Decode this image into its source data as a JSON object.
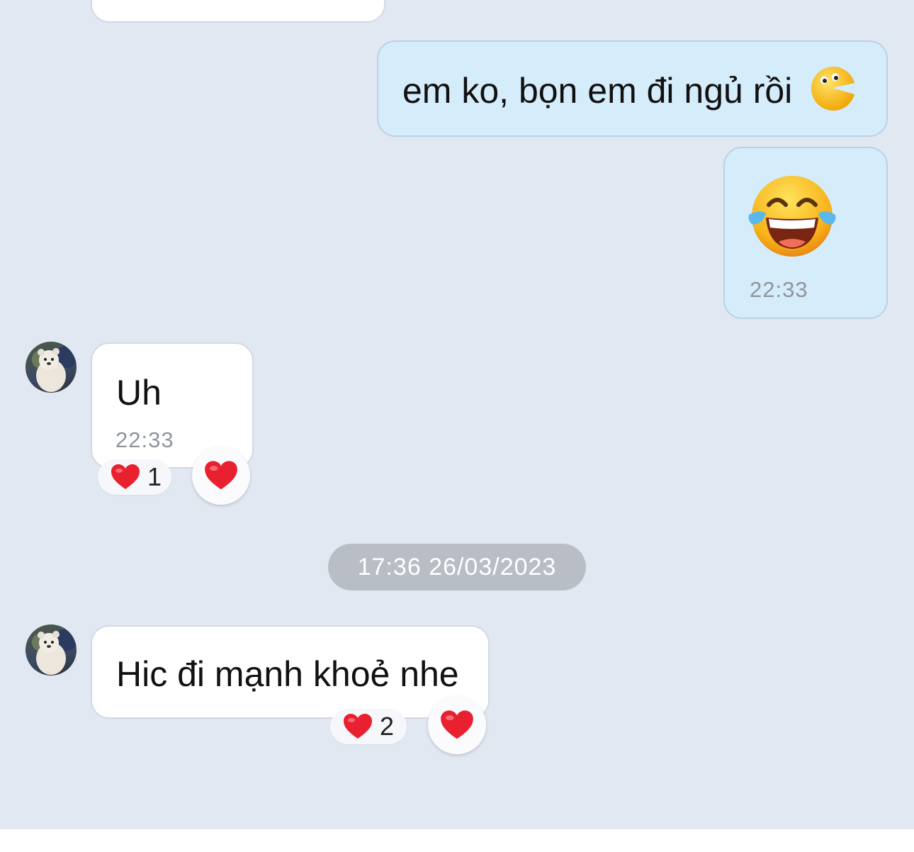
{
  "messages": [
    {
      "sender": "me",
      "text": "em ko, bọn em đi ngủ rồi",
      "sticker": "pacman-smiley-emoji"
    },
    {
      "sender": "me",
      "sticker": "tears-of-joy-emoji",
      "time": "22:33"
    },
    {
      "sender": "contact",
      "avatar": "polar-bear-avatar",
      "text": "Uh",
      "time": "22:33",
      "reaction": {
        "icon": "heart-icon",
        "count": "1"
      }
    },
    {
      "sender": "contact",
      "avatar": "polar-bear-avatar",
      "text": "Hic đi mạnh khoẻ nhe",
      "reaction": {
        "icon": "heart-icon",
        "count": "2"
      }
    }
  ],
  "date_separator": "17:36 26/03/2023",
  "colors": {
    "background": "#e2e8f2",
    "my_bubble": "#d5ecfb",
    "contact_bubble": "#ffffff",
    "heart": "#e8202f",
    "date_pill": "#b9bec6"
  }
}
